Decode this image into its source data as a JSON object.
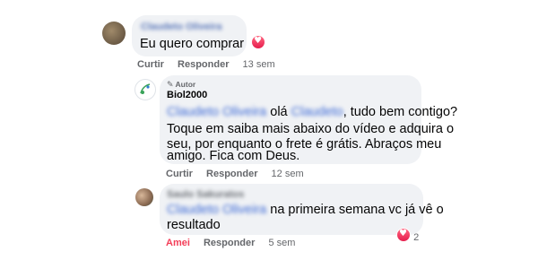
{
  "comments": [
    {
      "author": "Claudeto Oliveira",
      "text": "Eu quero comprar",
      "like_label": "Curtir",
      "reply_label": "Responder",
      "time": "13 sem"
    },
    {
      "author_badge": "Autor",
      "author": "Biol2000",
      "mention": "Claudeto Oliveira",
      "line1_greeting": "olá",
      "line1_mention2": "Claudeto",
      "line1_rest": ", tudo bem contigo?",
      "line2": "Toque em saiba mais abaixo do vídeo e adquira o",
      "line3": "seu, por enquanto o frete é grátis. Abraços meu",
      "line4": "amigo. Fica com Deus.",
      "like_label": "Curtir",
      "reply_label": "Responder",
      "time": "12 sem"
    },
    {
      "author": "Saulo Sakuratos",
      "mention": "Claudeto Oliveira",
      "line1_rest": "na primeira semana vc já vê o",
      "line2": "resultado",
      "like_label": "Amei",
      "reply_label": "Responder",
      "time": "5 sem",
      "reaction_count": "2"
    }
  ],
  "colors": {
    "bubble": "#f0f2f5",
    "link": "#3d6ad6",
    "love": "#f33e58",
    "meta": "#65676b"
  },
  "icons": [
    "heart-icon",
    "pencil-icon"
  ]
}
